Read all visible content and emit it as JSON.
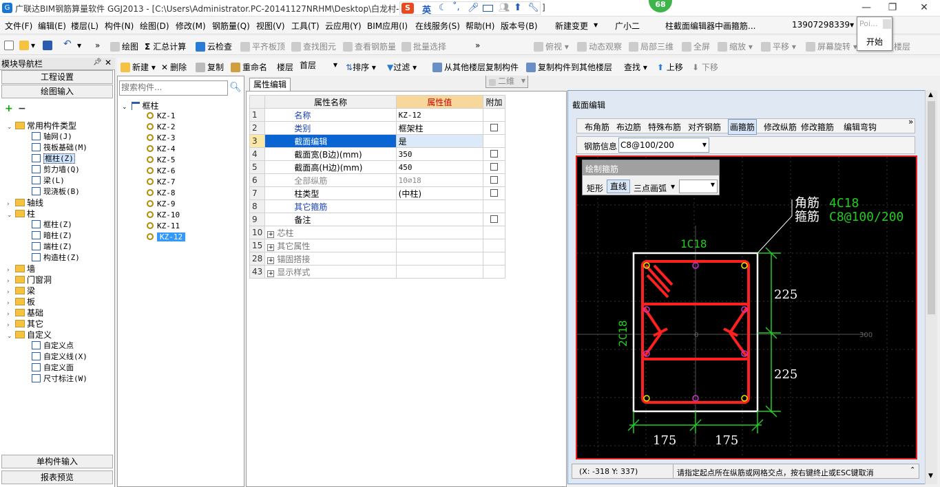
{
  "window": {
    "title": "广联达BIM钢筋算量软件 GGJ2013 - [C:\\Users\\Administrator.PC-20141127NRHM\\Desktop\\白龙村-",
    "title_suffix": "]",
    "ime_label": "英",
    "badge_count": "68",
    "popup_text": "Poi...",
    "popup_button": "开始"
  },
  "menu": [
    "文件(F)",
    "编辑(E)",
    "楼层(L)",
    "构件(N)",
    "绘图(D)",
    "修改(M)",
    "钢筋量(Q)",
    "视图(V)",
    "工具(T)",
    "云应用(Y)",
    "BIM应用(I)",
    "在线服务(S)",
    "帮助(H)",
    "版本号(B)",
    "新建变更",
    "广小二",
    "柱截面编辑器中画箍筋...",
    "13907298339"
  ],
  "toolbar1": {
    "draw": "绘图",
    "summary": "汇总计算",
    "cloud_check": "云检查",
    "level_top": "平齐板顶",
    "find_elem": "查找图元",
    "view_rebar": "查看钢筋量",
    "batch_select": "批量选择",
    "view_mode": "二维",
    "top_view": "俯视",
    "dynamic_view": "动态观察",
    "local_3d": "局部三维",
    "fullscreen": "全屏",
    "zoom": "缩放",
    "pan": "平移",
    "rotate": "屏幕旋转",
    "floor": "楼层"
  },
  "toolbar2": {
    "new": "新建",
    "delete": "删除",
    "copy": "复制",
    "rename": "重命名",
    "floor_label": "楼层",
    "floor_value": "首层",
    "sort": "排序",
    "filter": "过滤",
    "copy_from": "从其他楼层复制构件",
    "copy_to": "复制构件到其他楼层",
    "find": "查找",
    "up": "上移",
    "down": "下移"
  },
  "nav": {
    "title": "模块导航栏",
    "project_settings": "工程设置",
    "drawing_input": "绘图输入",
    "tree": [
      {
        "label": "常用构件类型",
        "level": 0,
        "type": "folder",
        "open": true
      },
      {
        "label": "轴网(J)",
        "level": 1,
        "type": "item"
      },
      {
        "label": "筏板基础(M)",
        "level": 1,
        "type": "item"
      },
      {
        "label": "框柱(Z)",
        "level": 1,
        "type": "item",
        "selected": true
      },
      {
        "label": "剪力墙(Q)",
        "level": 1,
        "type": "item"
      },
      {
        "label": "梁(L)",
        "level": 1,
        "type": "item"
      },
      {
        "label": "现浇板(B)",
        "level": 1,
        "type": "item"
      },
      {
        "label": "轴线",
        "level": 0,
        "type": "folder"
      },
      {
        "label": "柱",
        "level": 0,
        "type": "folder",
        "open": true
      },
      {
        "label": "框柱(Z)",
        "level": 1,
        "type": "item"
      },
      {
        "label": "暗柱(Z)",
        "level": 1,
        "type": "item"
      },
      {
        "label": "端柱(Z)",
        "level": 1,
        "type": "item"
      },
      {
        "label": "构造柱(Z)",
        "level": 1,
        "type": "item"
      },
      {
        "label": "墙",
        "level": 0,
        "type": "folder"
      },
      {
        "label": "门窗洞",
        "level": 0,
        "type": "folder"
      },
      {
        "label": "梁",
        "level": 0,
        "type": "folder"
      },
      {
        "label": "板",
        "level": 0,
        "type": "folder"
      },
      {
        "label": "基础",
        "level": 0,
        "type": "folder"
      },
      {
        "label": "其它",
        "level": 0,
        "type": "folder"
      },
      {
        "label": "自定义",
        "level": 0,
        "type": "folder",
        "open": true
      },
      {
        "label": "自定义点",
        "level": 1,
        "type": "item"
      },
      {
        "label": "自定义线(X)",
        "level": 1,
        "type": "item"
      },
      {
        "label": "自定义面",
        "level": 1,
        "type": "item"
      },
      {
        "label": "尺寸标注(W)",
        "level": 1,
        "type": "item"
      }
    ],
    "single_input": "单构件输入",
    "report_preview": "报表预览"
  },
  "components": {
    "search_placeholder": "搜索构件...",
    "root": "框柱",
    "items": [
      "KZ-1",
      "KZ-2",
      "KZ-3",
      "KZ-4",
      "KZ-5",
      "KZ-6",
      "KZ-7",
      "KZ-8",
      "KZ-9",
      "KZ-10",
      "KZ-11",
      "KZ-12"
    ],
    "selected": "KZ-12"
  },
  "props": {
    "tab": "属性编辑",
    "headers": [
      "属性名称",
      "属性值",
      "附加"
    ],
    "rows": [
      {
        "num": "1",
        "name": "名称",
        "value": "KZ-12",
        "check": false,
        "style": "blue"
      },
      {
        "num": "2",
        "name": "类别",
        "value": "框架柱",
        "check": true,
        "style": "blue"
      },
      {
        "num": "3",
        "name": "截面编辑",
        "value": "是",
        "check": false,
        "style": "sel"
      },
      {
        "num": "4",
        "name": "截面宽(B边)(mm)",
        "value": "350",
        "check": true,
        "style": "normal"
      },
      {
        "num": "5",
        "name": "截面高(H边)(mm)",
        "value": "450",
        "check": true,
        "style": "normal"
      },
      {
        "num": "6",
        "name": "全部纵筋",
        "value": "10⌀18",
        "check": true,
        "style": "gray"
      },
      {
        "num": "7",
        "name": "柱类型",
        "value": "(中柱)",
        "check": true,
        "style": "normal"
      },
      {
        "num": "8",
        "name": "其它箍筋",
        "value": "",
        "check": false,
        "style": "blue"
      },
      {
        "num": "9",
        "name": "备注",
        "value": "",
        "check": true,
        "style": "normal"
      },
      {
        "num": "10",
        "name": "芯柱",
        "value": "",
        "check": false,
        "style": "group"
      },
      {
        "num": "15",
        "name": "其它属性",
        "value": "",
        "check": false,
        "style": "group"
      },
      {
        "num": "28",
        "name": "锚固搭接",
        "value": "",
        "check": false,
        "style": "group"
      },
      {
        "num": "43",
        "name": "显示样式",
        "value": "",
        "check": false,
        "style": "group"
      }
    ]
  },
  "section": {
    "title": "截面编辑",
    "tabs": [
      "布角筋",
      "布边筋",
      "特殊布筋",
      "对齐钢筋",
      "画箍筋",
      "修改纵筋",
      "修改箍筋",
      "编辑弯钩"
    ],
    "active_tab": "画箍筋",
    "rebar_label": "钢筋信息",
    "rebar_value": "C8@100/200",
    "draw_popup_title": "绘制箍筋",
    "draw_modes": [
      "矩形",
      "直线",
      "三点画弧"
    ],
    "active_mode": "直线",
    "annot_corner_label": "角筋",
    "annot_corner_value": "4C18",
    "annot_stirrup_label": "箍筋",
    "annot_stirrup_value": "C8@100/200",
    "top_bar": "1C18",
    "side_bar": "2C18",
    "dim_225_top": "225",
    "dim_225_bottom": "225",
    "dim_175_left": "175",
    "dim_175_right": "175",
    "axis_zero": "0",
    "axis_300": "300",
    "coords": "(X: -318 Y: 337)",
    "status": "请指定起点所在纵筋或网格交点，按右键终止或ESC键取消"
  }
}
